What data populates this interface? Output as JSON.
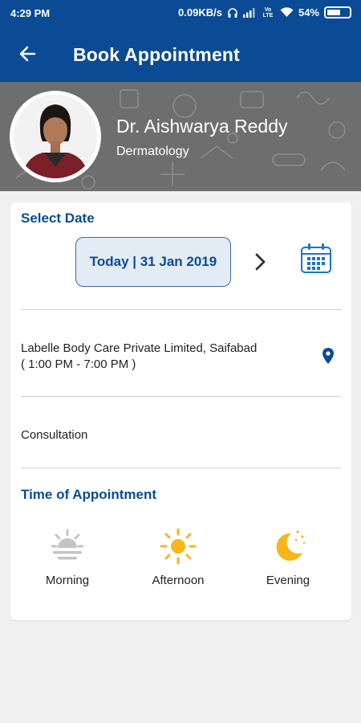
{
  "status_bar": {
    "time": "4:29 PM",
    "network_speed": "0.09KB/s",
    "carrier_label": "Vo LTE",
    "battery": "54%"
  },
  "app_bar": {
    "title": "Book Appointment",
    "back_icon": "arrow-left-icon"
  },
  "doctor": {
    "name": "Dr. Aishwarya Reddy",
    "specialty": "Dermatology"
  },
  "select_date": {
    "heading": "Select Date",
    "date_label": "Today | 31 Jan 2019",
    "next_icon": "chevron-right-icon",
    "calendar_icon": "calendar-icon"
  },
  "clinic": {
    "name": "Labelle Body Care Private Limited, Saifabad",
    "hours": "( 1:00 PM - 7:00 PM )",
    "location_icon": "map-pin-icon"
  },
  "consultation": {
    "label": "Consultation"
  },
  "time_of_appointment": {
    "heading": "Time of Appointment",
    "slots": [
      {
        "label": "Morning",
        "icon": "sunrise-icon",
        "state": "disabled"
      },
      {
        "label": "Afternoon",
        "icon": "sun-icon",
        "state": "enabled"
      },
      {
        "label": "Evening",
        "icon": "moon-icon",
        "state": "enabled"
      }
    ]
  },
  "colors": {
    "primary": "#0b4b96",
    "accent_sun": "#f7b718",
    "disabled_icon": "#c4c4c4",
    "background": "#f0f0f0"
  }
}
